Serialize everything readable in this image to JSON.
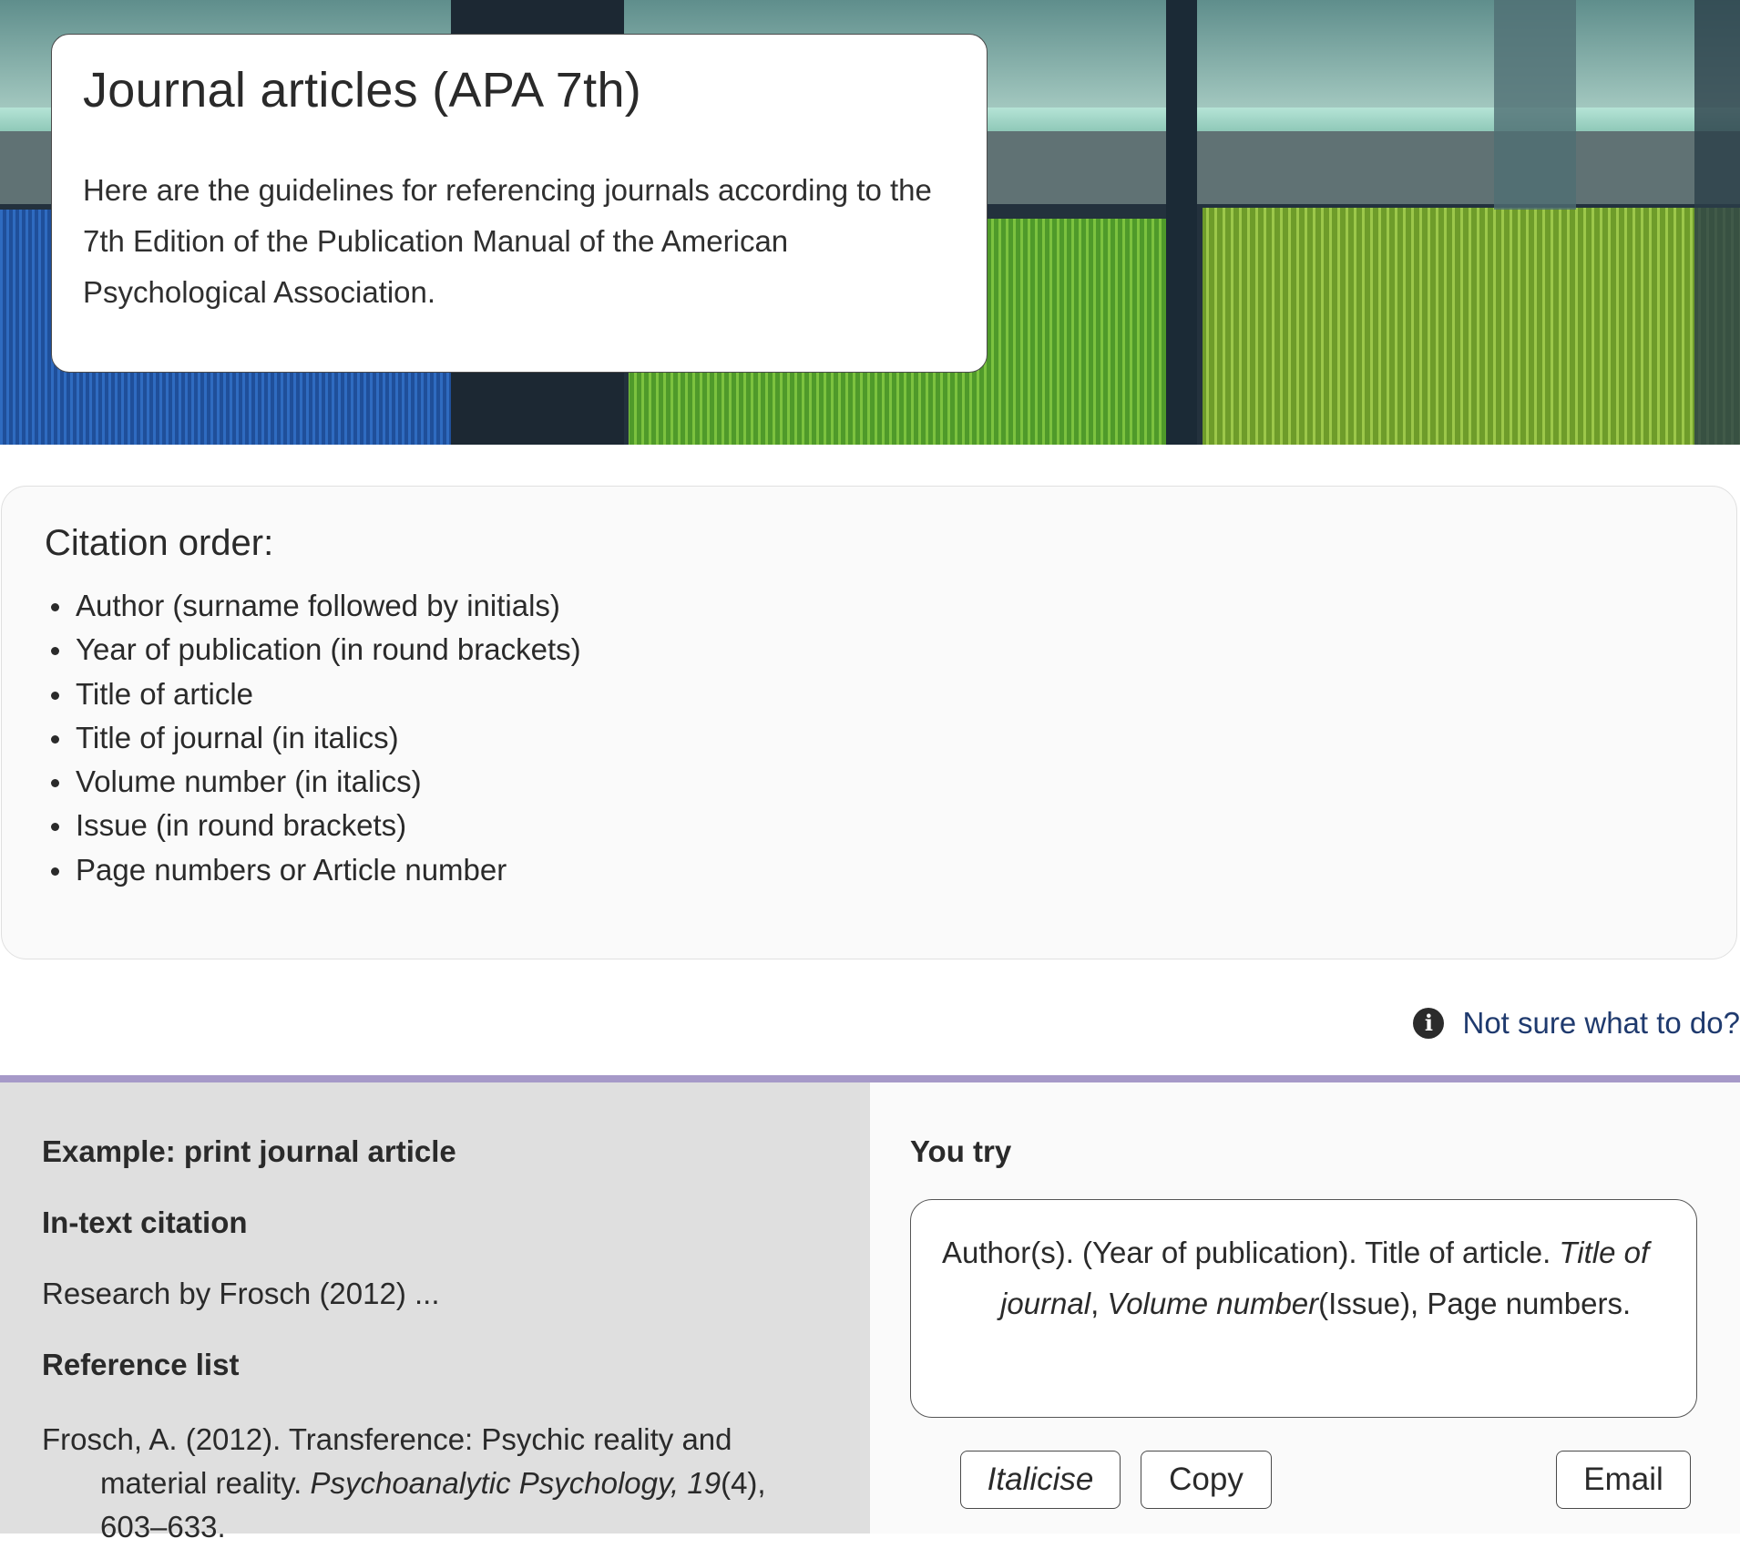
{
  "hero": {
    "title": "Journal articles (APA 7th)",
    "description": "Here are the guidelines for referencing journals according to the 7th Edition of the Publication Manual of the American Psychological Association."
  },
  "citation_order": {
    "heading": "Citation order:",
    "items": [
      "Author (surname followed by initials)",
      "Year of publication (in round brackets)",
      "Title of article",
      "Title of journal (in italics)",
      "Volume number (in italics)",
      "Issue (in round brackets)",
      "Page numbers or Article number"
    ]
  },
  "help": {
    "icon": "info-icon",
    "label": "Not sure what to do?"
  },
  "example": {
    "heading": "Example: print journal article",
    "in_text_heading": "In-text citation",
    "in_text": "Research by Frosch (2012) ...",
    "reference_heading": "Reference list",
    "reference_plain": "Frosch, A. (2012). Transference: Psychic reality and material reality.",
    "reference_journal": "Psychoanalytic Psychology, 19",
    "reference_tail": "(4), 603–633."
  },
  "try": {
    "heading": "You try",
    "template_plain": "Author(s). (Year of publication). Title of article.",
    "template_journal": "Title of journal",
    "template_sep": ",",
    "template_volume": "Volume number",
    "template_tail": "(Issue), Page numbers.",
    "buttons": {
      "italicise": "Italicise",
      "copy": "Copy",
      "email": "Email"
    }
  },
  "colors": {
    "accent_rule": "#a699c8",
    "link": "#1f3a6e",
    "example_bg": "#dfdfdf",
    "try_bg": "#fafafa"
  }
}
